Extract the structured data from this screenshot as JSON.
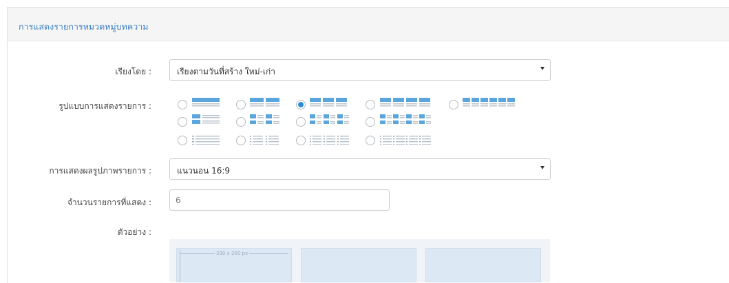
{
  "panel": {
    "title": "การแสดงรายการหมวดหมู่บทความ"
  },
  "sort": {
    "label": "เรียงโดย :",
    "value": "เรียงตามวันที่สร้าง ใหม่-เก่า"
  },
  "layout": {
    "label": "รูปแบบการแสดงรายการ :",
    "selected_index": 2,
    "options": [
      {
        "name": "layout-1-column-list"
      },
      {
        "name": "layout-2-column-list"
      },
      {
        "name": "layout-3-column-list"
      },
      {
        "name": "layout-4-column-list"
      },
      {
        "name": "layout-6-column-list"
      },
      {
        "name": "layout-1-column-thumb"
      },
      {
        "name": "layout-2-column-thumb"
      },
      {
        "name": "layout-3-column-thumb"
      },
      {
        "name": "layout-4-column-thumb"
      },
      {
        "name": "layout-1-column-text"
      },
      {
        "name": "layout-2-column-text"
      },
      {
        "name": "layout-3-column-text"
      },
      {
        "name": "layout-4-column-text"
      }
    ]
  },
  "image_display": {
    "label": "การแสดงผลรูปภาพรายการ :",
    "value": "แนวนอน 16:9"
  },
  "item_count": {
    "label": "จำนวนรายการที่แสดง :",
    "value": "6"
  },
  "preview": {
    "label": "ตัวอย่าง :",
    "size_text": "330 x 200 px"
  },
  "colors": {
    "accent": "#2b8fd6",
    "icon_blue": "#5aa6dc",
    "icon_grey": "#b9c3cc",
    "title": "#3a7fc4"
  }
}
